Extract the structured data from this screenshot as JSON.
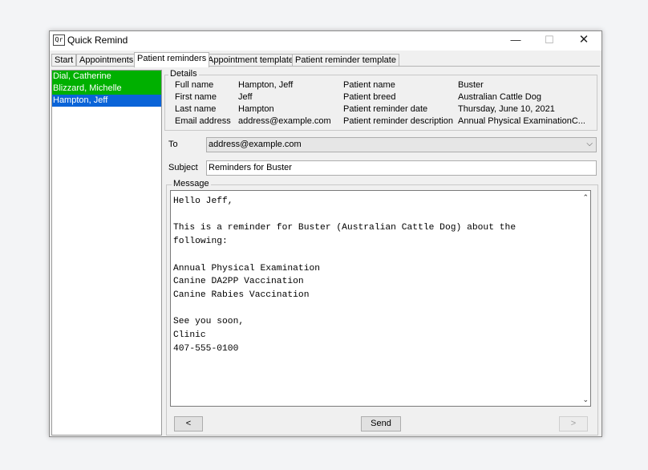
{
  "window": {
    "title": "Quick Remind",
    "app_icon": "Qr",
    "min_glyph": "—",
    "max_glyph": "☐",
    "close_glyph": "✕"
  },
  "tabs": [
    {
      "label": "Start"
    },
    {
      "label": "Appointments"
    },
    {
      "label": "Patient reminders"
    },
    {
      "label": "Appointment template"
    },
    {
      "label": "Patient reminder template"
    }
  ],
  "clients": [
    {
      "name": "Dial, Catherine"
    },
    {
      "name": "Blizzard, Michelle"
    },
    {
      "name": "Hampton, Jeff"
    }
  ],
  "details": {
    "title": "Details",
    "full_name_label": "Full name",
    "full_name": "Hampton, Jeff",
    "first_name_label": "First name",
    "first_name": "Jeff",
    "last_name_label": "Last name",
    "last_name": "Hampton",
    "email_label": "Email address",
    "email": "address@example.com",
    "patient_name_label": "Patient name",
    "patient_name": "Buster",
    "patient_breed_label": "Patient breed",
    "patient_breed": "Australian Cattle Dog",
    "reminder_date_label": "Patient reminder date",
    "reminder_date": "Thursday, June 10, 2021",
    "reminder_desc_label": "Patient reminder description",
    "reminder_desc": "Annual Physical ExaminationC..."
  },
  "email": {
    "to_label": "To",
    "to_value": "address@example.com",
    "chevron": "⌵",
    "subject_label": "Subject",
    "subject_value": "Reminders for Buster",
    "message_label": "Message",
    "message_body": "Hello Jeff,\n\nThis is a reminder for Buster (Australian Cattle Dog) about the\nfollowing:\n\nAnnual Physical Examination\nCanine DA2PP Vaccination\nCanine Rabies Vaccination\n\nSee you soon,\nClinic\n407-555-0100",
    "scroll_up": "⌃",
    "scroll_down": "⌄"
  },
  "buttons": {
    "prev": "<",
    "send": "Send",
    "next": ">"
  }
}
